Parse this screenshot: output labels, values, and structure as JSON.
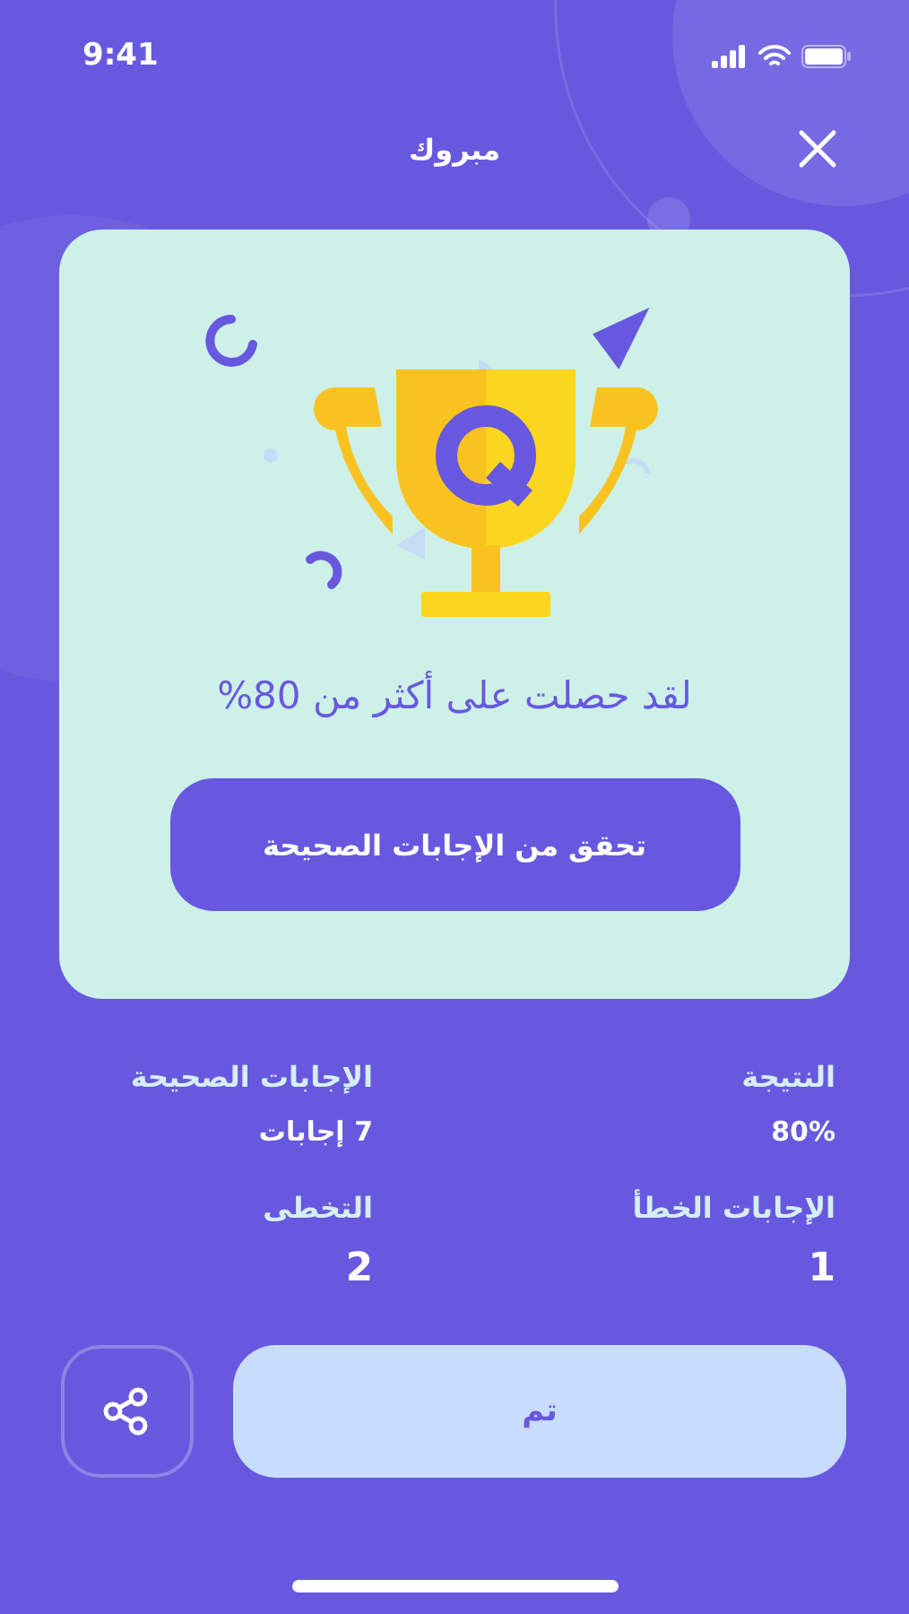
{
  "status_bar": {
    "time": "9:41"
  },
  "header": {
    "title": "مبروك"
  },
  "card": {
    "message": "لقد حصلت على أكثر من 80%",
    "button": "تحقق من الإجابات الصحيحة"
  },
  "stats": [
    {
      "label": "النتيجة",
      "value": "80%"
    },
    {
      "label": "الإجابات الصحيحة",
      "value": "7 إجابات"
    },
    {
      "label": "الإجابات الخطأ",
      "value": "1"
    },
    {
      "label": "التخطى",
      "value": "2"
    }
  ],
  "footer": {
    "done_button": "تم"
  }
}
